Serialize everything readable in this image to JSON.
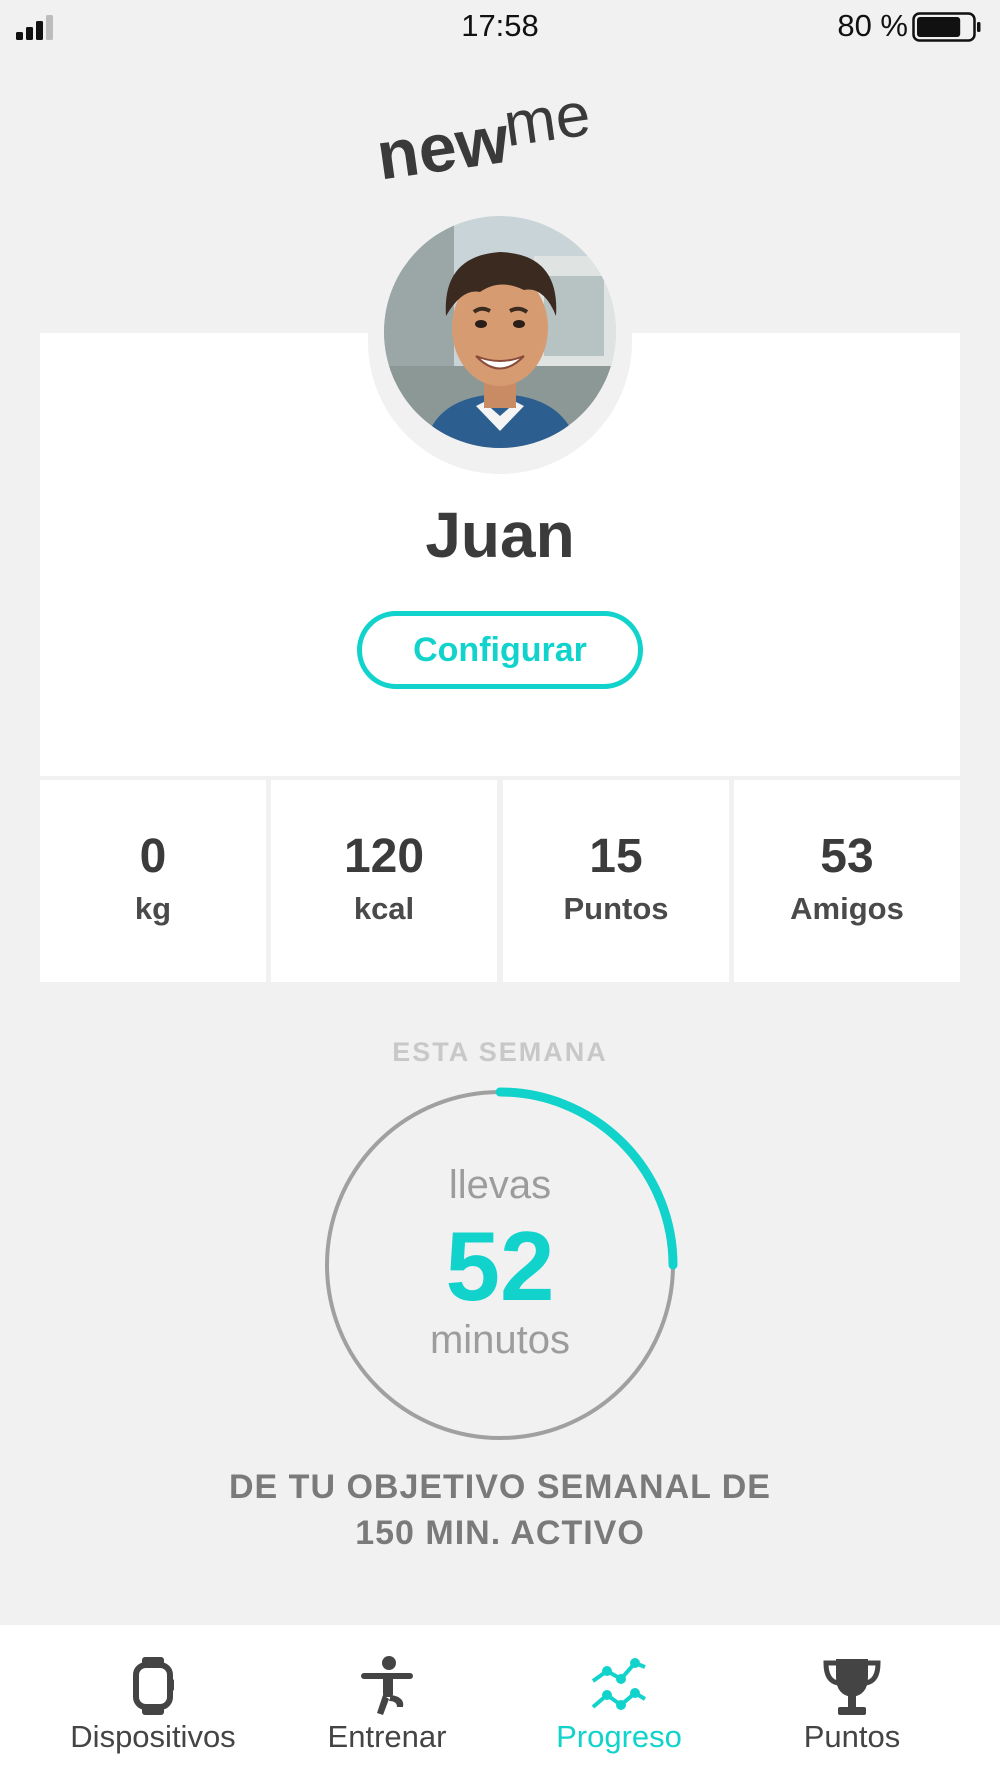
{
  "status_bar": {
    "time": "17:58",
    "battery_percent": "80 %",
    "battery_level": 0.8,
    "signal_bars": 3,
    "signal_max": 4
  },
  "app": {
    "logo_text": "newme",
    "accent_color": "#12d3cc"
  },
  "profile": {
    "name": "Juan",
    "configure_label": "Configurar"
  },
  "stats": [
    {
      "value": "0",
      "label": "kg"
    },
    {
      "value": "120",
      "label": "kcal"
    },
    {
      "value": "15",
      "label": "Puntos"
    },
    {
      "value": "53",
      "label": "Amigos"
    }
  ],
  "weekly": {
    "section_title": "ESTA SEMANA",
    "prefix": "llevas",
    "minutes": "52",
    "suffix": "minutos",
    "goal_line1": "DE TU OBJETIVO SEMANAL DE",
    "goal_line2": "150 MIN. ACTIVO",
    "progress_fraction": 0.25
  },
  "tabs": [
    {
      "label": "Dispositivos",
      "icon": "watch-icon",
      "active": false
    },
    {
      "label": "Entrenar",
      "icon": "exercise-figure-icon",
      "active": false
    },
    {
      "label": "Progreso",
      "icon": "progress-chart-icon",
      "active": true
    },
    {
      "label": "Puntos",
      "icon": "trophy-icon",
      "active": false
    }
  ]
}
